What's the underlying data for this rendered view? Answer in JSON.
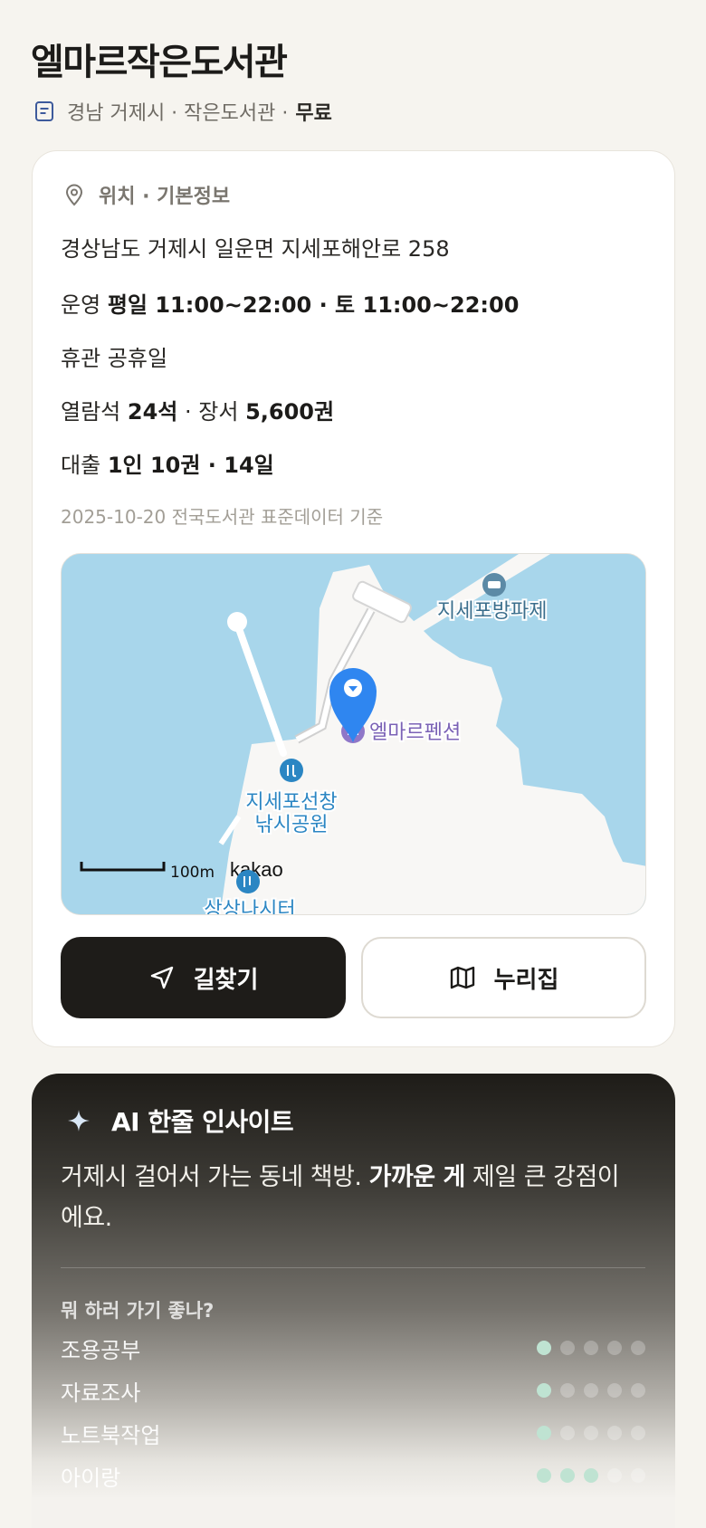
{
  "page": {
    "title": "엘마르작은도서관",
    "meta": {
      "region": "경남 거제시 · 작은도서관 · ",
      "fee": "무료",
      "icon": "document-icon"
    }
  },
  "info": {
    "section_title": "위치 · 기본정보",
    "address": "경상남도 거제시 일운면 지세포해안로 258",
    "hours_label": "운영",
    "hours_value": "평일 11:00~22:00 · 토 11:00~22:00",
    "closed": "휴관 공휴일",
    "seats_label": "열람석",
    "seats_value": "24석",
    "books_sep": " · 장서 ",
    "books_value": "5,600권",
    "loan_label": "대출",
    "loan_value": "1인 10권 · 14일",
    "basis": "2025-10-20 전국도서관 표준데이터 기준"
  },
  "map": {
    "labels": {
      "breakwater": "지세포방파제",
      "pension": "엘마르펜션",
      "park_line1": "지세포선창",
      "park_line2": "낚시공원",
      "scale": "100m",
      "brand": "kakao",
      "bottom_label": "상상나시터"
    },
    "colors": {
      "water": "#a8d6eb",
      "land": "#f8f7f5",
      "pin": "#2f86f0",
      "poi_text": "#3a6e8c",
      "park_text": "#2b86c3",
      "pension_text": "#7b62b6"
    }
  },
  "actions": {
    "directions": {
      "label": "길찾기",
      "icon": "navigation-arrow-icon"
    },
    "nurijip": {
      "label": "누리집",
      "icon": "map-icon"
    }
  },
  "ai": {
    "title": "AI 한줄 인사이트",
    "text_before": "거제시 걸어서 가는 동네 책방. ",
    "text_bold": "가까운 게",
    "text_after": " 제일 큰 강점이에요.",
    "question": "뭐 하러 가기 좋나?",
    "ratings": [
      {
        "name": "조용공부",
        "score": 1,
        "max": 5
      },
      {
        "name": "자료조사",
        "score": 1,
        "max": 5
      },
      {
        "name": "노트북작업",
        "score": 1,
        "max": 5
      },
      {
        "name": "아이랑",
        "score": 3,
        "max": 5
      }
    ]
  }
}
